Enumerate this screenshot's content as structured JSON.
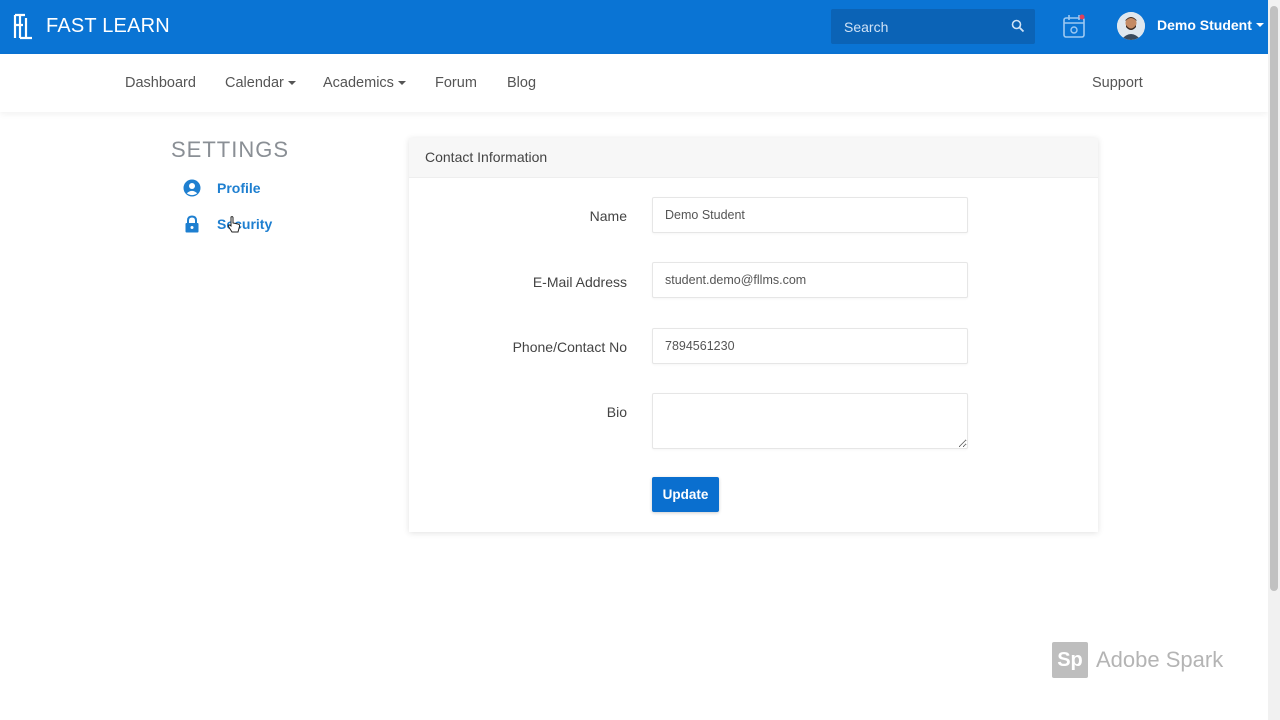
{
  "topbar": {
    "brand_name": "FAST LEARN",
    "search_placeholder": "Search",
    "user_name": "Demo Student",
    "icons": [
      "brand-logo-icon",
      "search-icon",
      "calendar-icon",
      "avatar",
      "chevron-down-icon"
    ],
    "bg_color": "#0a74d4"
  },
  "nav": {
    "items": [
      {
        "label": "Dashboard"
      },
      {
        "label": "Calendar",
        "dropdown": true
      },
      {
        "label": "Academics",
        "dropdown": true
      },
      {
        "label": "Forum"
      },
      {
        "label": "Blog"
      }
    ],
    "support_label": "Support"
  },
  "settings": {
    "title": "SETTINGS",
    "items": [
      {
        "label": "Profile",
        "icon": "user-circle-icon"
      },
      {
        "label": "Security",
        "icon": "lock-icon"
      }
    ]
  },
  "card": {
    "header": "Contact Information",
    "fields": [
      {
        "label": "Name",
        "value": "Demo Student"
      },
      {
        "label": "E-Mail Address",
        "value": "student.demo@fllms.com"
      },
      {
        "label": "Phone/Contact No",
        "value": "7894561230"
      },
      {
        "label": "Bio",
        "value": ""
      }
    ],
    "update_label": "Update",
    "accent_color": "#0a6fcf"
  },
  "watermark": {
    "badge": "Sp",
    "text": "Adobe Spark"
  }
}
